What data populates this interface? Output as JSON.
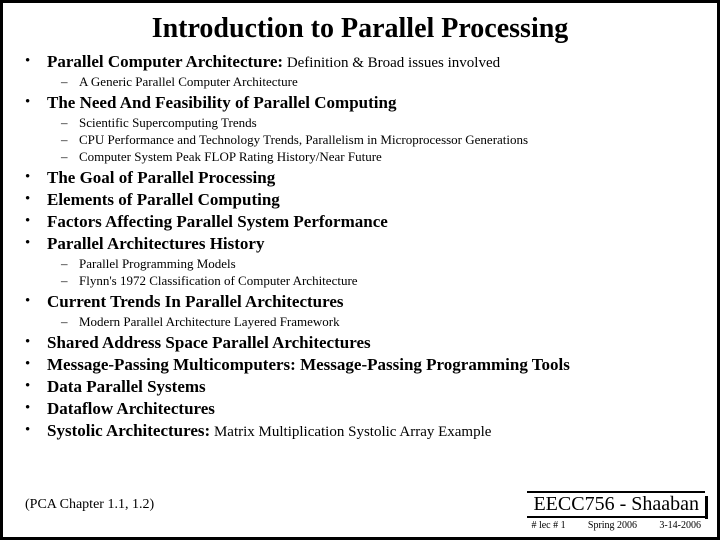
{
  "title": "Introduction to Parallel Processing",
  "bullets": [
    {
      "text": "Parallel Computer Architecture:",
      "suffix": " Definition & Broad issues involved",
      "sub": [
        "A Generic Parallel Computer Architecture"
      ]
    },
    {
      "text": "The Need And Feasibility of Parallel Computing",
      "sub": [
        "Scientific Supercomputing Trends",
        "CPU Performance and Technology Trends, Parallelism in Microprocessor Generations",
        "Computer System Peak FLOP Rating History/Near Future"
      ]
    },
    {
      "text": "The Goal of Parallel Processing"
    },
    {
      "text": "Elements of Parallel Computing"
    },
    {
      "text": "Factors Affecting Parallel System Performance"
    },
    {
      "text": "Parallel Architectures History",
      "sub": [
        "Parallel Programming Models",
        "Flynn's 1972 Classification of Computer Architecture"
      ]
    },
    {
      "text": "Current Trends In Parallel Architectures",
      "sub": [
        "Modern Parallel Architecture Layered Framework"
      ]
    },
    {
      "text": "Shared Address Space Parallel Architectures"
    },
    {
      "text": "Message-Passing Multicomputers: Message-Passing Programming Tools"
    },
    {
      "text": "Data Parallel Systems"
    },
    {
      "text": "Dataflow Architectures"
    },
    {
      "text": "Systolic Architectures:",
      "suffix": " Matrix Multiplication Systolic Array Example"
    }
  ],
  "footer": {
    "left": "(PCA Chapter 1.1, 1.2)",
    "course": "EECC756 - Shaaban",
    "lec": "#  lec # 1",
    "term": "Spring 2006",
    "date": "3-14-2006"
  }
}
